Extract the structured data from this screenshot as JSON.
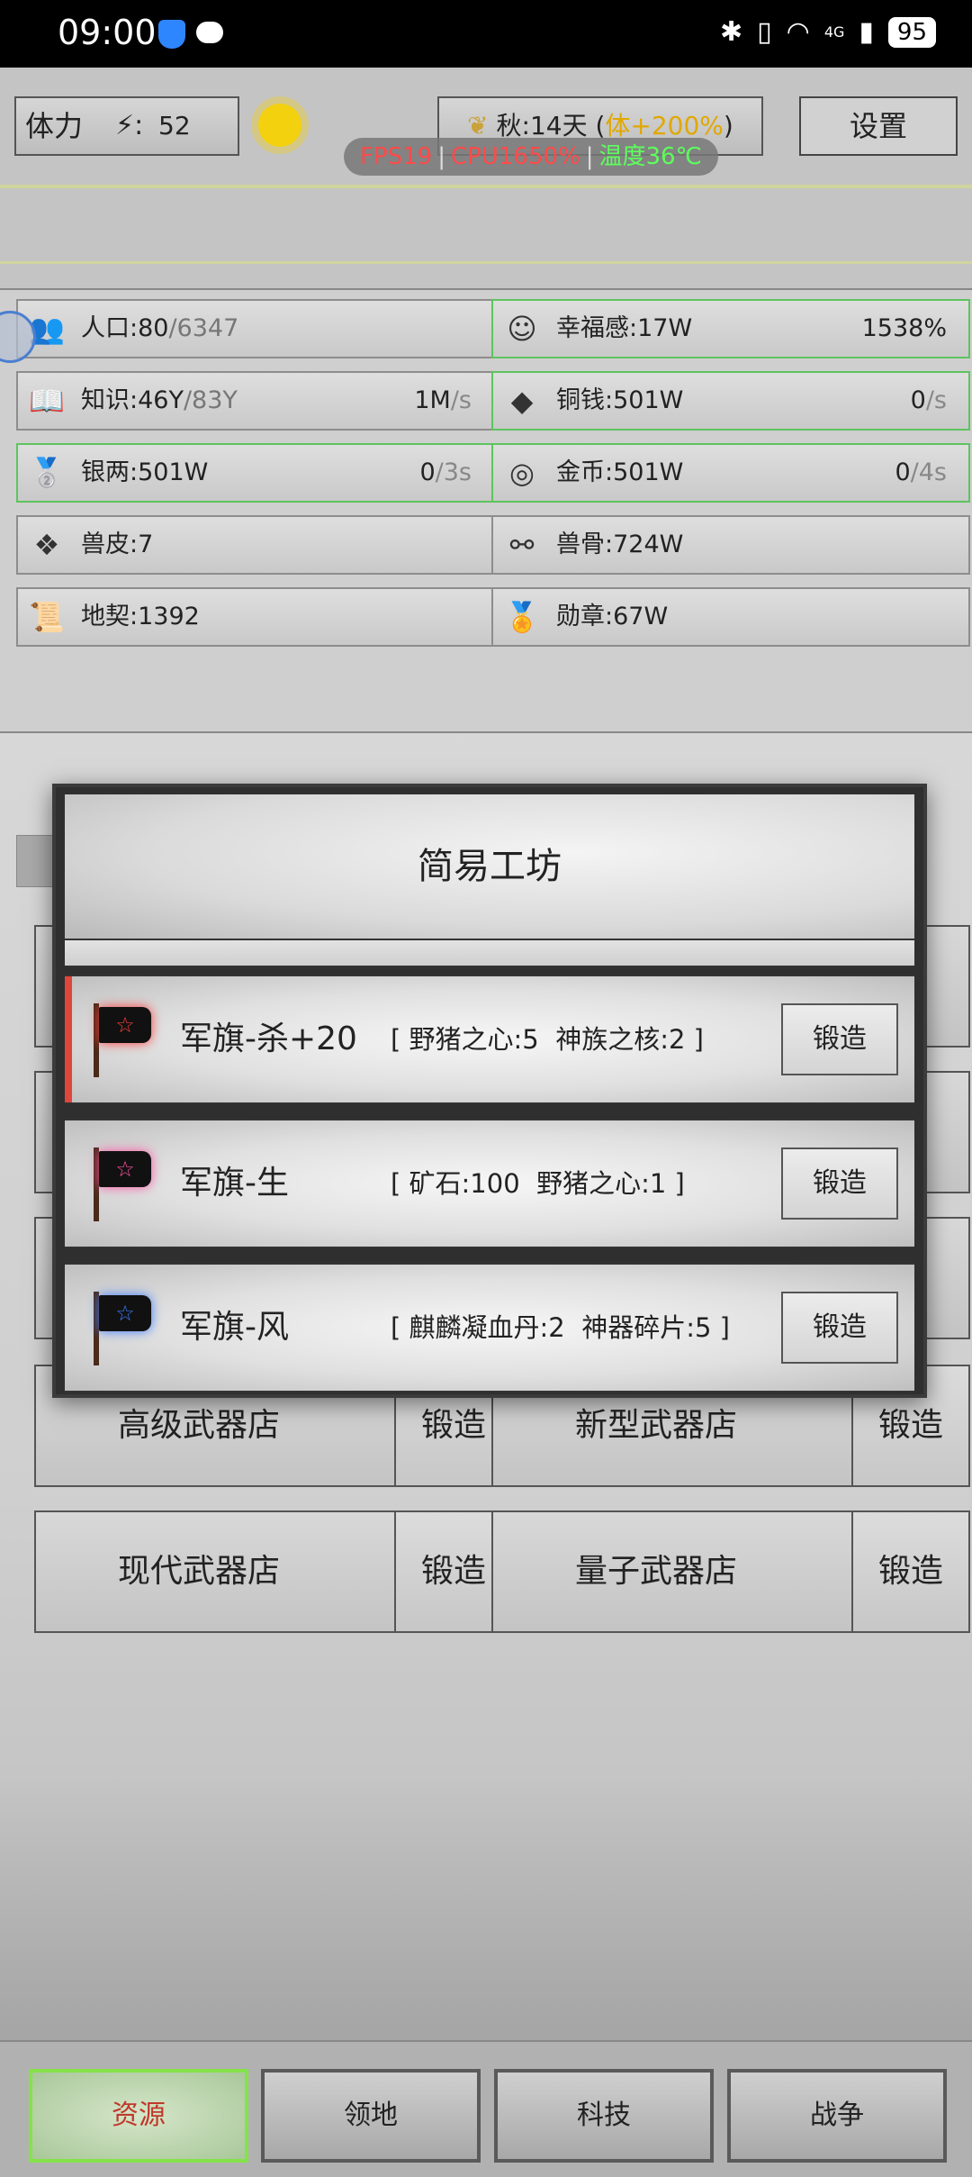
{
  "status_bar": {
    "time": "09:00",
    "network": "4G",
    "battery": "95"
  },
  "header": {
    "stamina_label": "体力",
    "stamina_sep": ":",
    "stamina_value": "52",
    "season_text": "秋:14天 (",
    "season_bonus": "体+200%",
    "season_close": ")",
    "settings_label": "设置"
  },
  "perf": {
    "fps": "FPS19",
    "cpu": "CPU1650%",
    "temp": "温度36℃"
  },
  "resources": [
    {
      "icon": "people-icon",
      "glyph": "👥",
      "name": "人口:80",
      "max": "/6347",
      "rate": "",
      "unit": "",
      "highlight": false
    },
    {
      "icon": "smile-icon",
      "glyph": "☺",
      "name": "幸福感:17W",
      "max": "",
      "rate": "1538%",
      "unit": "",
      "highlight": true
    },
    {
      "icon": "book-icon",
      "glyph": "📖",
      "name": "知识:46Y",
      "max": "/83Y",
      "rate": "1M",
      "unit": "/s",
      "highlight": false
    },
    {
      "icon": "copper-coin-icon",
      "glyph": "◆",
      "name": "铜钱:501W",
      "max": "",
      "rate": "0",
      "unit": "/s",
      "highlight": true
    },
    {
      "icon": "silver-ingot-icon",
      "glyph": "🥈",
      "name": "银两:501W",
      "max": "",
      "rate": "0",
      "unit": "/3s",
      "highlight": true
    },
    {
      "icon": "gold-coin-icon",
      "glyph": "◎",
      "name": "金币:501W",
      "max": "",
      "rate": "0",
      "unit": "/4s",
      "highlight": true
    },
    {
      "icon": "hide-icon",
      "glyph": "❖",
      "name": "兽皮:7",
      "max": "",
      "rate": "",
      "unit": "",
      "highlight": false
    },
    {
      "icon": "bone-icon",
      "glyph": "⚯",
      "name": "兽骨:724W",
      "max": "",
      "rate": "",
      "unit": "",
      "highlight": false
    },
    {
      "icon": "deed-icon",
      "glyph": "📜",
      "name": "地契:1392",
      "max": "",
      "rate": "",
      "unit": "",
      "highlight": false
    },
    {
      "icon": "medal-icon",
      "glyph": "🏅",
      "name": "勋章:67W",
      "max": "",
      "rate": "",
      "unit": "",
      "highlight": false
    }
  ],
  "shops": [
    {
      "name": "高级武器店",
      "button": "锻造"
    },
    {
      "name": "新型武器店",
      "button": "锻造"
    },
    {
      "name": "现代武器店",
      "button": "锻造"
    },
    {
      "name": "量子武器店",
      "button": "锻造"
    }
  ],
  "modal": {
    "title": "简易工坊",
    "recipes": [
      {
        "name": "军旗-杀+20",
        "materials": "[ 野猪之心:5  神族之核:2 ]",
        "button": "锻造",
        "flag_color": "#ff3b3b",
        "selected": true
      },
      {
        "name": "军旗-生",
        "materials": "[ 矿石:100  野猪之心:1 ]",
        "button": "锻造",
        "flag_color": "#ff4fa0",
        "selected": false
      },
      {
        "name": "军旗-风",
        "materials": "[ 麒麟凝血丹:2  神器碎片:5 ]",
        "button": "锻造",
        "flag_color": "#3a7bff",
        "selected": false
      }
    ]
  },
  "nav": [
    {
      "label": "资源",
      "active": true
    },
    {
      "label": "领地",
      "active": false
    },
    {
      "label": "科技",
      "active": false
    },
    {
      "label": "战争",
      "active": false
    }
  ]
}
